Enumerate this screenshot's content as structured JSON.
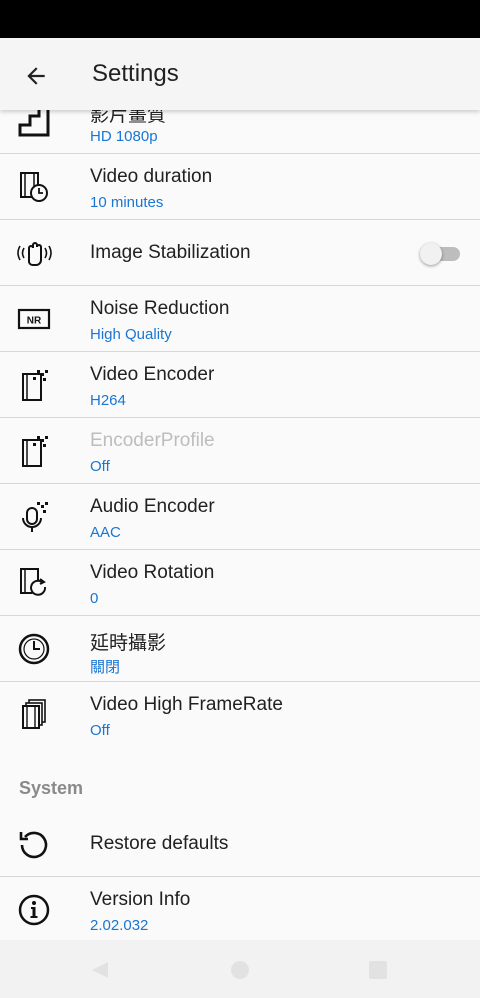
{
  "app_bar": {
    "title": "Settings"
  },
  "rows": [
    {
      "title": "影片畫質",
      "sub": "HD 1080p",
      "icon": "quality-steps-icon"
    },
    {
      "title": "Video duration",
      "sub": "10 minutes",
      "icon": "video-timer-icon"
    },
    {
      "title": "Image Stabilization",
      "icon": "stabilization-hand-icon",
      "toggle": false
    },
    {
      "title": "Noise Reduction",
      "sub": "High Quality",
      "icon": "noise-reduction-icon"
    },
    {
      "title": "Video Encoder",
      "sub": "H264",
      "icon": "video-encoder-icon"
    },
    {
      "title": "EncoderProfile",
      "sub": "Off",
      "icon": "encoder-profile-icon",
      "disabled": true
    },
    {
      "title": "Audio Encoder",
      "sub": "AAC",
      "icon": "audio-encoder-icon"
    },
    {
      "title": "Video Rotation",
      "sub": "0",
      "icon": "video-rotation-icon"
    },
    {
      "title": "延時攝影",
      "sub": "關閉",
      "icon": "timelapse-clock-icon"
    },
    {
      "title": "Video High FrameRate",
      "sub": "Off",
      "icon": "high-framerate-icon"
    }
  ],
  "system": {
    "header": "System",
    "restore": {
      "title": "Restore defaults",
      "icon": "restore-icon"
    },
    "version": {
      "title": "Version Info",
      "sub": "2.02.032",
      "icon": "info-icon"
    }
  },
  "nav": {
    "back": "nav-back-icon",
    "home": "nav-home-icon",
    "recents": "nav-recents-icon"
  }
}
